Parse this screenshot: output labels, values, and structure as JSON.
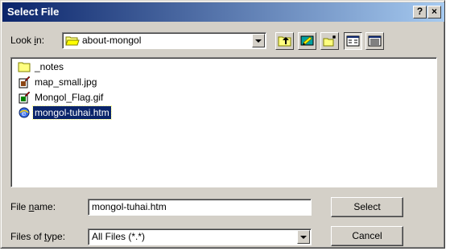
{
  "dialog": {
    "title": "Select File",
    "help_button": "?",
    "close_button": "×"
  },
  "lookin": {
    "label_prefix": "Look ",
    "label_accel": "i",
    "label_suffix": "n:",
    "value": "about-mongol"
  },
  "toolbar": {
    "up_folder_icon": "up-one-level-icon",
    "desktop_icon": "desktop-icon",
    "new_folder_icon": "new-folder-icon",
    "list_view_icon": "list-view-icon",
    "details_view_icon": "details-view-icon"
  },
  "files": [
    {
      "name": "_notes",
      "icon": "folder-icon",
      "selected": false
    },
    {
      "name": "map_small.jpg",
      "icon": "jpg-file-icon",
      "selected": false
    },
    {
      "name": "Mongol_Flag.gif",
      "icon": "gif-file-icon",
      "selected": false
    },
    {
      "name": "mongol-tuhai.htm",
      "icon": "htm-file-icon",
      "selected": true
    }
  ],
  "filename": {
    "label_prefix": "File ",
    "label_accel": "n",
    "label_suffix": "ame:",
    "value": "mongol-tuhai.htm"
  },
  "filetype": {
    "label_prefix": "Files of ",
    "label_accel": "t",
    "label_suffix": "ype:",
    "value": "All Files (*.*)"
  },
  "buttons": {
    "select": "Select",
    "cancel": "Cancel"
  },
  "colors": {
    "title_start": "#0a246a",
    "title_end": "#a6caf0",
    "face": "#d4d0c8",
    "selection": "#0a246a"
  }
}
